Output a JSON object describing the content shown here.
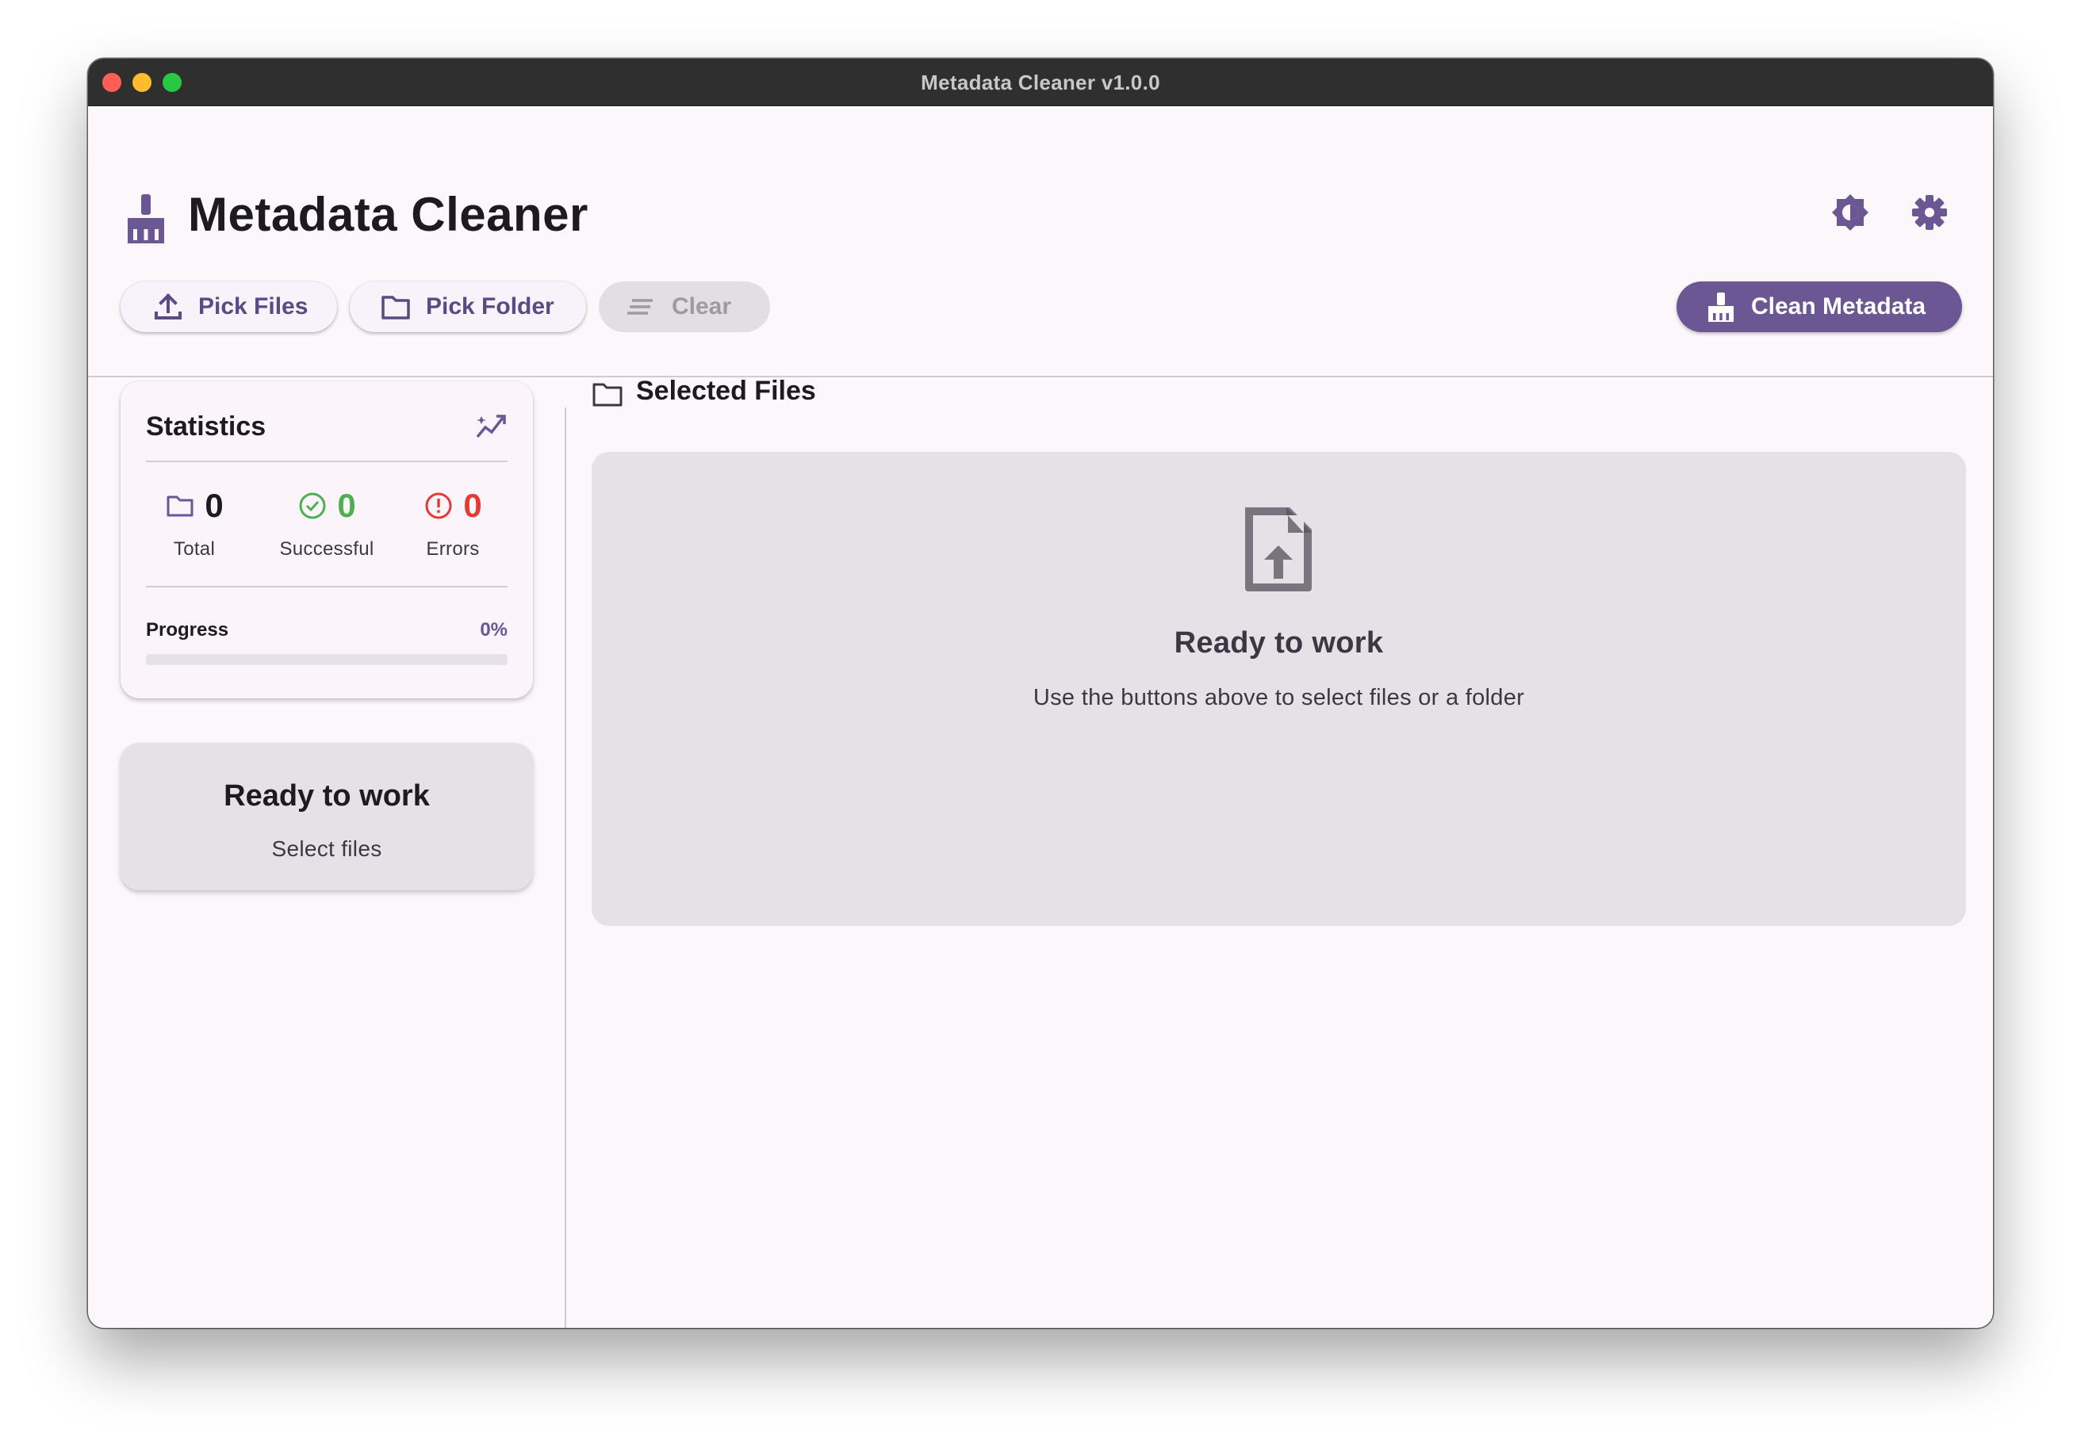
{
  "window": {
    "title": "Metadata Cleaner v1.0.0"
  },
  "header": {
    "app_title": "Metadata Cleaner",
    "brand_icon": "broom-icon",
    "theme_icon": "brightness-contrast-icon",
    "settings_icon": "gear-icon"
  },
  "toolbar": {
    "pick_files_label": "Pick Files",
    "pick_folder_label": "Pick Folder",
    "clear_label": "Clear",
    "clean_label": "Clean Metadata"
  },
  "statistics": {
    "title": "Statistics",
    "total": {
      "value": "0",
      "label": "Total",
      "color": "#1d1b20"
    },
    "successful": {
      "value": "0",
      "label": "Successful",
      "color": "#4caf50"
    },
    "errors": {
      "value": "0",
      "label": "Errors",
      "color": "#e53935"
    },
    "progress_label": "Progress",
    "progress_text": "0%",
    "progress_fraction": 0
  },
  "status": {
    "title": "Ready to work",
    "subtitle": "Select files"
  },
  "files": {
    "title": "Selected Files",
    "empty_title": "Ready to work",
    "empty_subtitle": "Use the buttons above to select files or a folder"
  },
  "colors": {
    "accent": "#6a5794",
    "success": "#4caf50",
    "error": "#e53935",
    "background": "#fcf7fb"
  }
}
